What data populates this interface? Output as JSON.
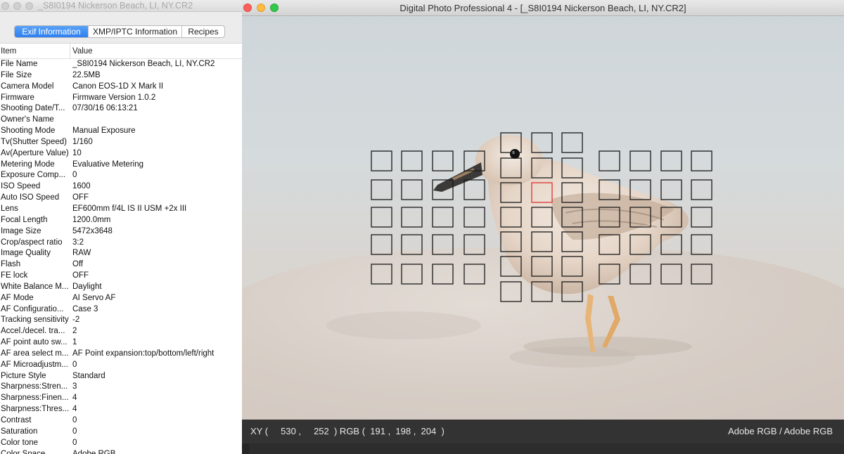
{
  "info_window": {
    "title": "_S8I0194 Nickerson Beach, LI, NY.CR2",
    "tabs": [
      "Exif Information",
      "XMP/IPTC Information",
      "Recipes"
    ],
    "active_tab": 0,
    "columns": [
      "Item",
      "Value"
    ],
    "rows": [
      [
        "File Name",
        "_S8I0194 Nickerson Beach, LI, NY.CR2"
      ],
      [
        "File Size",
        "22.5MB"
      ],
      [
        "Camera Model",
        "Canon EOS-1D X Mark II"
      ],
      [
        "Firmware",
        "Firmware Version 1.0.2"
      ],
      [
        "Shooting Date/T...",
        "07/30/16 06:13:21"
      ],
      [
        "Owner's Name",
        ""
      ],
      [
        "Shooting Mode",
        "Manual Exposure"
      ],
      [
        "Tv(Shutter Speed)",
        "1/160"
      ],
      [
        "Av(Aperture Value)",
        "10"
      ],
      [
        "Metering Mode",
        "Evaluative Metering"
      ],
      [
        "Exposure Comp...",
        "0"
      ],
      [
        "ISO Speed",
        "1600"
      ],
      [
        "Auto ISO Speed",
        "OFF"
      ],
      [
        "Lens",
        "EF600mm f/4L IS II USM +2x III"
      ],
      [
        "Focal Length",
        "1200.0mm"
      ],
      [
        "Image Size",
        "5472x3648"
      ],
      [
        "Crop/aspect ratio",
        "3:2"
      ],
      [
        "Image Quality",
        "RAW"
      ],
      [
        "Flash",
        "Off"
      ],
      [
        "FE lock",
        "OFF"
      ],
      [
        "White Balance M...",
        "Daylight"
      ],
      [
        "AF Mode",
        "AI Servo AF"
      ],
      [
        "AF Configuratio...",
        "Case 3"
      ],
      [
        "Tracking sensitivity",
        "-2"
      ],
      [
        "Accel./decel. tra...",
        "2"
      ],
      [
        "AF point auto sw...",
        "1"
      ],
      [
        "AF area select m...",
        "AF Point expansion:top/bottom/left/right"
      ],
      [
        "AF Microadjustm...",
        "0"
      ],
      [
        "Picture Style",
        "Standard"
      ],
      [
        "Sharpness:Stren...",
        "3"
      ],
      [
        "Sharpness:Finen...",
        "4"
      ],
      [
        "Sharpness:Thres...",
        "4"
      ],
      [
        "Contrast",
        "0"
      ],
      [
        "Saturation",
        "0"
      ],
      [
        "Color tone",
        "0"
      ],
      [
        "Color Space",
        "Adobe RGB"
      ]
    ]
  },
  "main_window": {
    "title": "Digital Photo Professional 4 - [_S8I0194 Nickerson Beach, LI, NY.CR2]",
    "status": {
      "xy_readout": "XY (     530 ,     252  ) RGB (  191 ,  198 ,  204  )",
      "color_space": "Adobe RGB / Adobe RGB"
    },
    "af_point_colors": {
      "normal": "#1a1a1a",
      "selected": "#e03030"
    }
  }
}
